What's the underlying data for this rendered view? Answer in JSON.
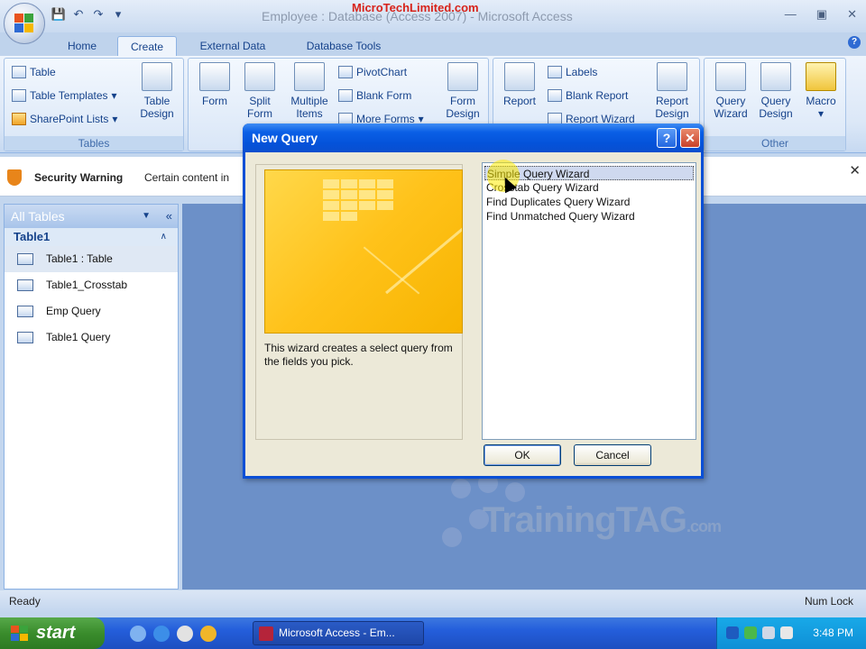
{
  "window": {
    "title": "Employee : Database (Access 2007) - Microsoft Access",
    "watermark": "MicroTechLimited.com"
  },
  "tabs": [
    "Home",
    "Create",
    "External Data",
    "Database Tools"
  ],
  "ribbon": {
    "tables": {
      "label": "Tables",
      "table": "Table",
      "table_templates": "Table Templates",
      "sharepoint_lists": "SharePoint Lists",
      "table_design": [
        "Table",
        "Design"
      ]
    },
    "forms": {
      "form": "Form",
      "split_form": [
        "Split",
        "Form"
      ],
      "multiple_items": [
        "Multiple",
        "Items"
      ],
      "pivotchart": "PivotChart",
      "blank_form": "Blank Form",
      "more_forms": "More Forms",
      "form_design": [
        "Form",
        "Design"
      ]
    },
    "reports": {
      "report": "Report",
      "labels": "Labels",
      "blank_report": "Blank Report",
      "report_wizard": "Report Wizard",
      "report_design": [
        "Report",
        "Design"
      ]
    },
    "other": {
      "label": "Other",
      "query_wizard": [
        "Query",
        "Wizard"
      ],
      "query_design": [
        "Query",
        "Design"
      ],
      "macro": "Macro"
    }
  },
  "security": {
    "title": "Security Warning",
    "text": "Certain content in"
  },
  "nav": {
    "header": "All Tables",
    "group": "Table1",
    "items": [
      "Table1 : Table",
      "Table1_Crosstab",
      "Emp  Query",
      "Table1 Query"
    ]
  },
  "dialog": {
    "title": "New Query",
    "description": "This wizard creates a select query from the fields you pick.",
    "options": [
      "Simple Query Wizard",
      "Crosstab Query Wizard",
      "Find Duplicates Query Wizard",
      "Find Unmatched Query Wizard"
    ],
    "ok": "OK",
    "cancel": "Cancel"
  },
  "brand_watermark": {
    "main": "TrainingTAG",
    "suffix": ".com"
  },
  "status": {
    "left": "Ready",
    "right": "Num Lock"
  },
  "taskbar": {
    "start": "start",
    "task": "Microsoft Access - Em...",
    "clock": "3:48 PM"
  },
  "colors": {
    "accent": "#15428b",
    "dialog_title": "#0a5fe6",
    "workspace": "#6c90c8"
  }
}
